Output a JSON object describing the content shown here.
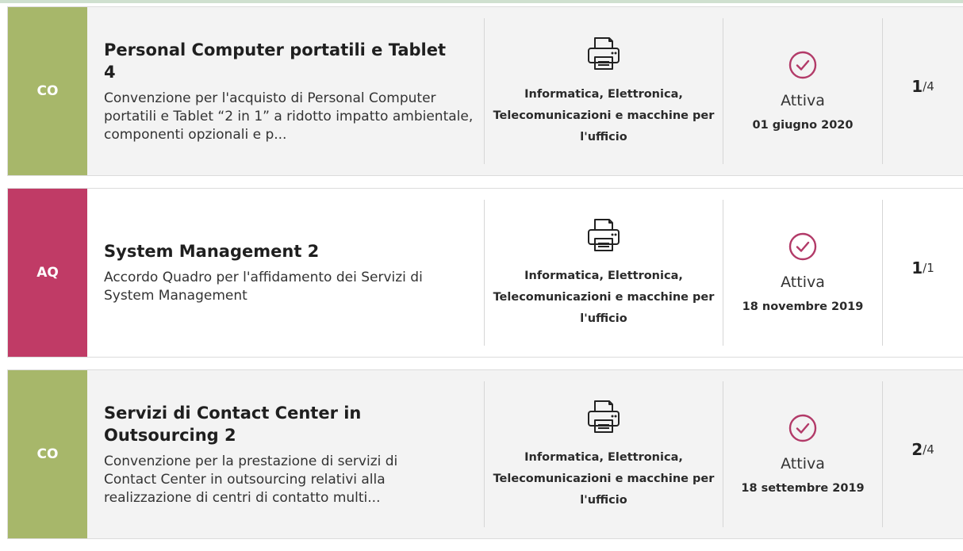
{
  "colors": {
    "badge_co": "#a7b76a",
    "badge_aq": "#c03b66",
    "check": "#b23a68"
  },
  "items": [
    {
      "badge": "CO",
      "title": "Personal Computer portatili e Tablet 4",
      "description": "Convenzione per l'acquisto di Personal Computer portatili e Tablet “2 in 1” a ridotto impatto ambientale, componenti opzionali e p...",
      "category_icon": "printer-icon",
      "category": "Informatica, Elettronica, Telecomunicazioni e macchine per l'ufficio",
      "status_icon": "check-circle-icon",
      "status": "Attiva",
      "date": "01 giugno 2020",
      "count_current": "1",
      "count_total": "/4"
    },
    {
      "badge": "AQ",
      "title": "System Management 2",
      "description": "Accordo Quadro per l'affidamento dei Servizi di System Management",
      "category_icon": "printer-icon",
      "category": "Informatica, Elettronica, Telecomunicazioni e macchine per l'ufficio",
      "status_icon": "check-circle-icon",
      "status": "Attiva",
      "date": "18 novembre 2019",
      "count_current": "1",
      "count_total": "/1"
    },
    {
      "badge": "CO",
      "title": "Servizi di Contact Center in Outsourcing 2",
      "description": "Convenzione per la prestazione di servizi di Contact Center in outsourcing relativi alla realizzazione di centri di contatto multi...",
      "category_icon": "printer-icon",
      "category": "Informatica, Elettronica, Telecomunicazioni e macchine per l'ufficio",
      "status_icon": "check-circle-icon",
      "status": "Attiva",
      "date": "18 settembre 2019",
      "count_current": "2",
      "count_total": "/4"
    }
  ]
}
